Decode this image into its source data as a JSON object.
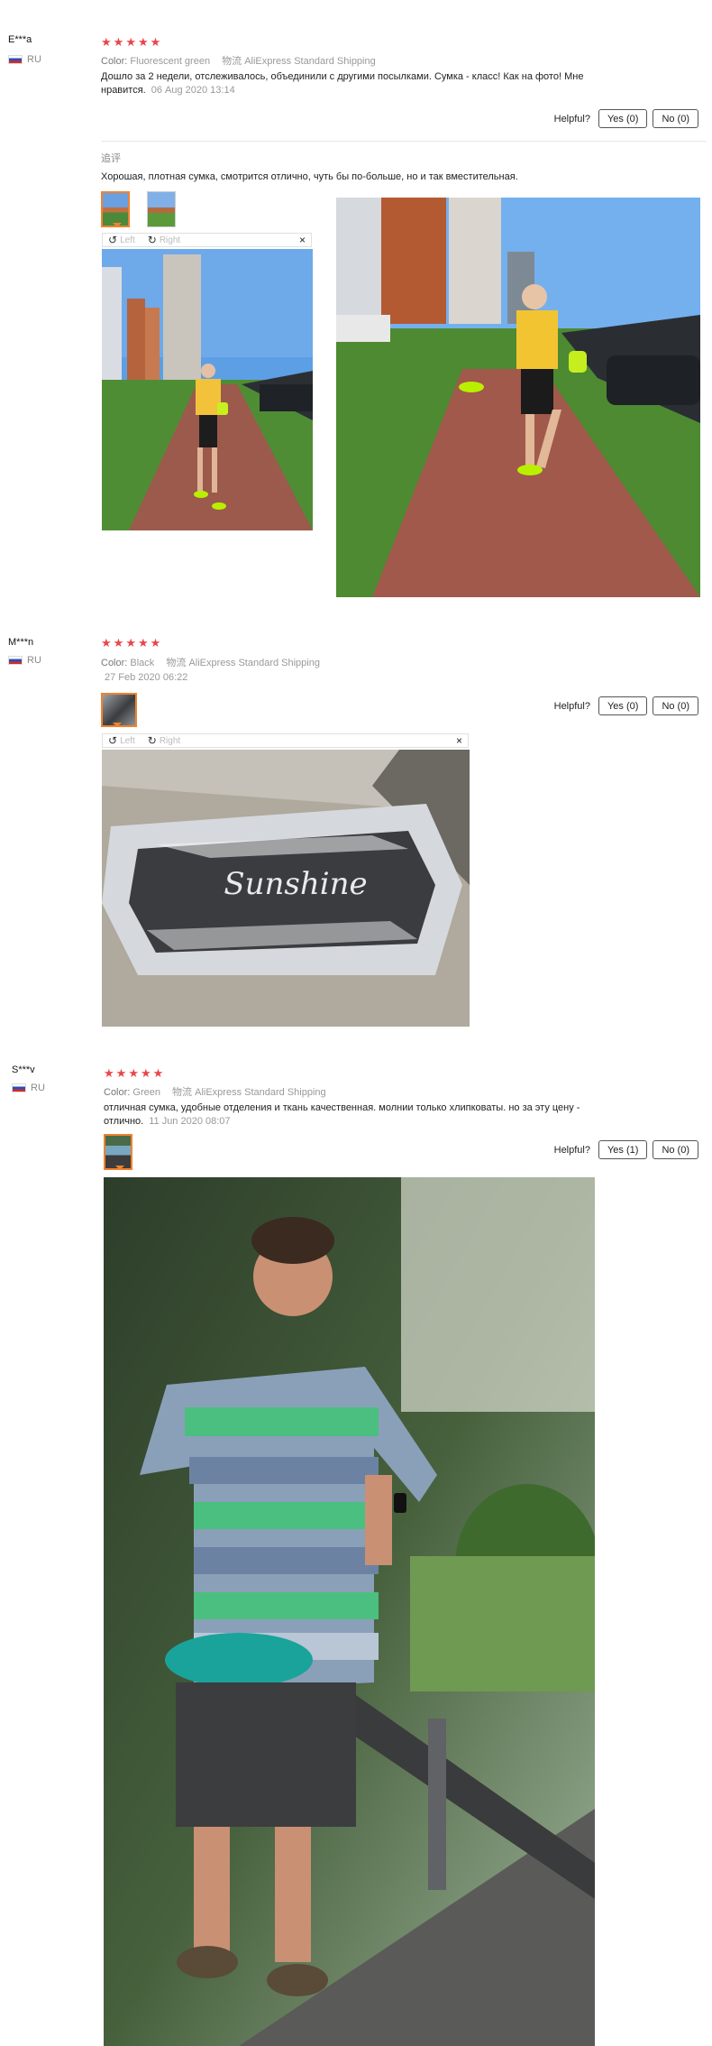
{
  "reviews": [
    {
      "user": "E***a",
      "country": "RU",
      "color_label": "Color:",
      "color_value": "Fluorescent green",
      "ship_label": "物流",
      "ship_value": "AliExpress Standard Shipping",
      "text": "Дошло за 2 недели, отслеживалось, объединили с другими посылками. Сумка - класс! Как на фото! Мне нравится.",
      "date": "06 Aug 2020 13:14",
      "helpful_label": "Helpful?",
      "yes_label": "Yes (0)",
      "no_label": "No (0)",
      "additional": {
        "title": "追评",
        "text": "Хорошая, плотная сумка, смотрится отлично, чуть бы по-больше, но и так вместительная."
      },
      "viewer": {
        "left": "Left",
        "right": "Right",
        "close": "×"
      }
    },
    {
      "user": "M***n",
      "country": "RU",
      "color_label": "Color:",
      "color_value": "Black",
      "ship_label": "物流",
      "ship_value": "AliExpress Standard Shipping",
      "date": "27 Feb 2020 06:22",
      "helpful_label": "Helpful?",
      "yes_label": "Yes (0)",
      "no_label": "No (0)",
      "viewer": {
        "left": "Left",
        "right": "Right",
        "close": "×"
      },
      "photo_text": "Sunshine"
    },
    {
      "user": "S***v",
      "country": "RU",
      "color_label": "Color:",
      "color_value": "Green",
      "ship_label": "物流",
      "ship_value": "AliExpress Standard Shipping",
      "text": "отличная сумка, удобные отделения и ткань качественная. молнии только хлипковаты. но за эту цену - отлично.",
      "date": "11 Jun 2020 08:07",
      "helpful_label": "Helpful?",
      "yes_label": "Yes (1)",
      "no_label": "No (0)"
    }
  ],
  "colors": {
    "star": "#e7464b",
    "active_thumb": "#f0822e"
  }
}
